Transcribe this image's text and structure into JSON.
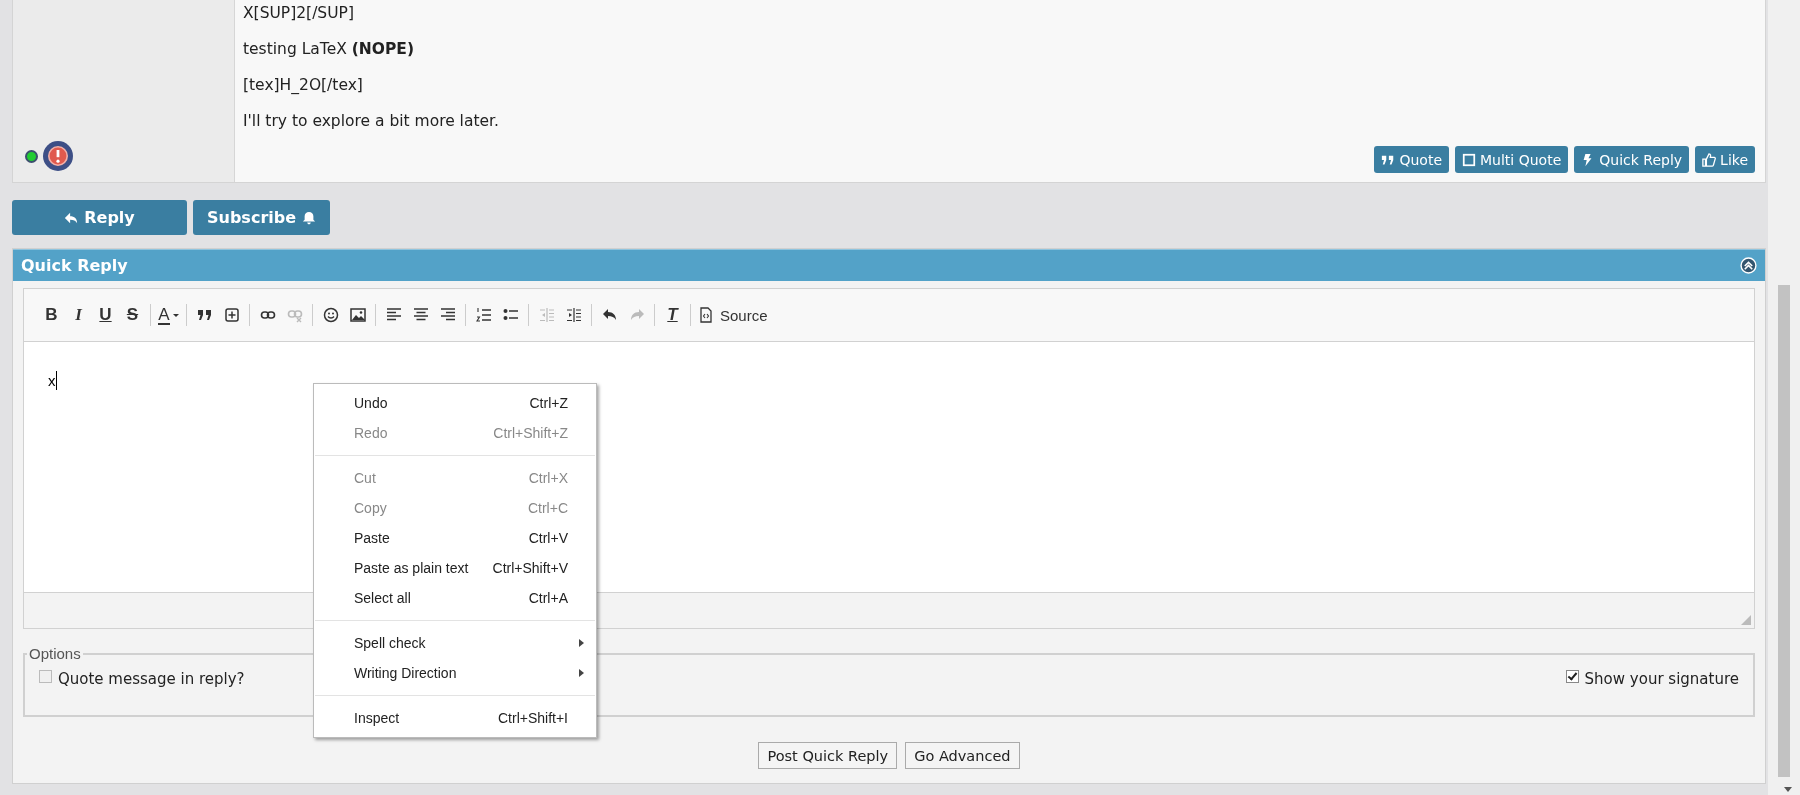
{
  "post": {
    "lines": [
      "X[SUP]2[/SUP]",
      "testing LaTeX **(NOPE)**",
      "[tex]H_2O[/tex]",
      "I'll try to explore a bit more later."
    ],
    "online": true,
    "actions": [
      {
        "label": "Quote"
      },
      {
        "label": "Multi Quote"
      },
      {
        "label": "Quick Reply"
      },
      {
        "label": "Like"
      }
    ]
  },
  "thread_buttons": [
    {
      "label": "Reply"
    },
    {
      "label": "Subscribe"
    }
  ],
  "quick_reply": {
    "title": "Quick Reply",
    "expanded": true,
    "toolbar": [
      [
        {
          "kind": "bold",
          "label": "B",
          "disabled": false
        },
        {
          "kind": "italic",
          "label": "I",
          "disabled": false
        },
        {
          "kind": "underline",
          "label": "U",
          "disabled": false
        },
        {
          "kind": "strike",
          "label": "S",
          "disabled": false
        }
      ],
      [
        {
          "kind": "color",
          "label": "A",
          "disabled": false
        }
      ],
      [
        {
          "kind": "quote",
          "disabled": false
        },
        {
          "kind": "plusbox",
          "disabled": false
        }
      ],
      [
        {
          "kind": "link",
          "disabled": false
        },
        {
          "kind": "unlink",
          "disabled": true
        }
      ],
      [
        {
          "kind": "smiley",
          "disabled": false
        },
        {
          "kind": "image",
          "disabled": false
        }
      ],
      [
        {
          "kind": "alignleft",
          "disabled": false
        },
        {
          "kind": "aligncenter",
          "disabled": false
        },
        {
          "kind": "alignright",
          "disabled": false
        }
      ],
      [
        {
          "kind": "numbered",
          "disabled": false
        },
        {
          "kind": "bulleted",
          "disabled": false
        }
      ],
      [
        {
          "kind": "outdent",
          "disabled": true
        },
        {
          "kind": "indent",
          "disabled": false
        }
      ],
      [
        {
          "kind": "undo",
          "disabled": false
        },
        {
          "kind": "redo",
          "disabled": true
        }
      ],
      [
        {
          "kind": "clear",
          "label": "T",
          "disabled": false
        }
      ],
      [
        {
          "kind": "source",
          "label": "Source",
          "disabled": false
        }
      ]
    ],
    "content": "x",
    "options": {
      "legend": "Options",
      "items": [
        {
          "label": "Quote message in reply?",
          "checked": false
        },
        {
          "label": "Show your signature",
          "checked": true
        }
      ]
    },
    "buttons": [
      "Post Quick Reply",
      "Go Advanced"
    ]
  },
  "context_menu": [
    [
      {
        "label": "Undo",
        "shortcut": "Ctrl+Z",
        "disabled": false,
        "submenu": false
      },
      {
        "label": "Redo",
        "shortcut": "Ctrl+Shift+Z",
        "disabled": true,
        "submenu": false
      }
    ],
    [
      {
        "label": "Cut",
        "shortcut": "Ctrl+X",
        "disabled": true,
        "submenu": false
      },
      {
        "label": "Copy",
        "shortcut": "Ctrl+C",
        "disabled": true,
        "submenu": false
      },
      {
        "label": "Paste",
        "shortcut": "Ctrl+V",
        "disabled": false,
        "submenu": false
      },
      {
        "label": "Paste as plain text",
        "shortcut": "Ctrl+Shift+V",
        "disabled": false,
        "submenu": false
      },
      {
        "label": "Select all",
        "shortcut": "Ctrl+A",
        "disabled": false,
        "submenu": false
      }
    ],
    [
      {
        "label": "Spell check",
        "disabled": false,
        "submenu": true
      },
      {
        "label": "Writing Direction",
        "disabled": false,
        "submenu": true
      }
    ],
    [
      {
        "label": "Inspect",
        "shortcut": "Ctrl+Shift+I",
        "disabled": false,
        "submenu": false
      }
    ]
  ]
}
